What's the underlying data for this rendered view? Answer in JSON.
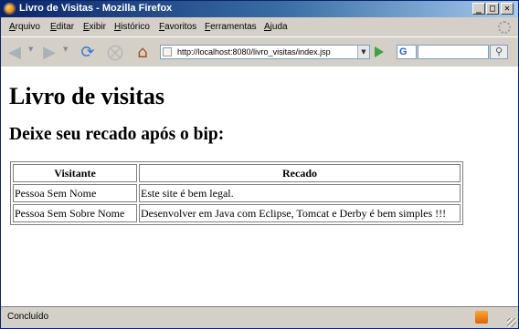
{
  "window": {
    "title": "Livro de Visitas - Mozilla Firefox",
    "buttons": {
      "minimize": "_",
      "maximize": "□",
      "close": "✕"
    }
  },
  "menu": [
    "Arquivo",
    "Editar",
    "Exibir",
    "Histórico",
    "Favoritos",
    "Ferramentas",
    "Ajuda"
  ],
  "toolbar": {
    "back_icon": "back-arrow-icon",
    "forward_icon": "forward-arrow-icon",
    "reload_icon": "reload-icon",
    "stop_icon": "stop-icon",
    "home_icon": "home-icon",
    "url": "http://localhost:8080/livro_visitas/index.jsp",
    "search_engine": "G",
    "search_value": ""
  },
  "page": {
    "heading": "Livro de visitas",
    "subheading": "Deixe seu recado após o bip:",
    "table": {
      "headers": [
        "Visitante",
        "Recado"
      ],
      "rows": [
        [
          "Pessoa Sem Nome",
          "Este site é bem legal."
        ],
        [
          "Pessoa Sem Sobre Nome",
          "Desenvolver em Java com Eclipse, Tomcat e Derby é bem simples !!!"
        ]
      ]
    }
  },
  "status": {
    "text": "Concluído"
  }
}
